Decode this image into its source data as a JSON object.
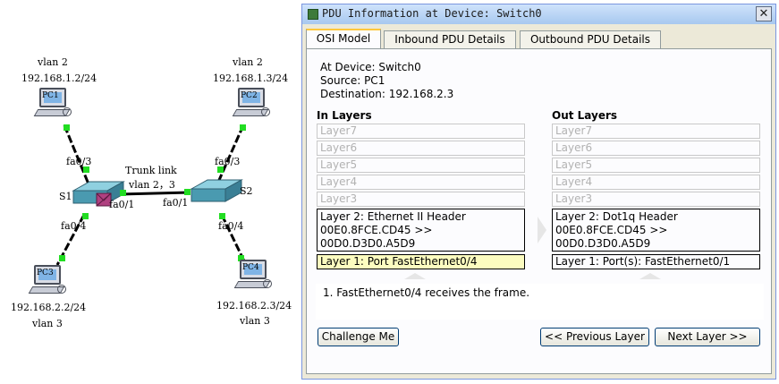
{
  "topology": {
    "pc1": {
      "label": "PC1",
      "vlan": "vlan 2",
      "ip": "192.168.1.2/24",
      "port": "fa0/3"
    },
    "pc2": {
      "label": "PC2",
      "vlan": "vlan 2",
      "ip": "192.168.1.3/24",
      "port": "fa0/3"
    },
    "pc3": {
      "label": "PC3",
      "vlan": "vlan 3",
      "ip": "192.168.2.2/24",
      "port": "fa0/4"
    },
    "pc4": {
      "label": "PC4",
      "vlan": "vlan 3",
      "ip": "192.168.2.3/24",
      "port": "fa0/4"
    },
    "s1": {
      "label": "S1",
      "trunk_port": "fa0/1"
    },
    "s2": {
      "label": "S2",
      "trunk_port": "fa0/1"
    },
    "trunk": {
      "label": "Trunk link",
      "vlans": "vlan 2，3"
    },
    "colors": {
      "link": "#000000",
      "port_led": "#22dd22",
      "switch": "#4a9ab0",
      "pdu": "#b04080"
    }
  },
  "dialog": {
    "title": "PDU Information at Device: Switch0",
    "close_glyph": "✕",
    "tabs": [
      "OSI Model",
      "Inbound PDU Details",
      "Outbound PDU Details"
    ],
    "active_tab": "OSI Model",
    "at_device": "At Device: Switch0",
    "source": "Source: PC1",
    "destination": "Destination: 192.168.2.3",
    "in_layers": {
      "header": "In Layers",
      "inactive": [
        "Layer7",
        "Layer6",
        "Layer5",
        "Layer4",
        "Layer3"
      ],
      "layer2": [
        "Layer 2: Ethernet II Header",
        "00E0.8FCE.CD45 >>",
        "00D0.D3D0.A5D9"
      ],
      "layer1": "Layer 1: Port FastEthernet0/4"
    },
    "out_layers": {
      "header": "Out Layers",
      "inactive": [
        "Layer7",
        "Layer6",
        "Layer5",
        "Layer4",
        "Layer3"
      ],
      "layer2": [
        "Layer 2: Dot1q Header",
        "00E0.8FCE.CD45 >>",
        "00D0.D3D0.A5D9"
      ],
      "layer1": "Layer 1: Port(s): FastEthernet0/1"
    },
    "description": "1. FastEthernet0/4 receives the frame.",
    "buttons": {
      "challenge": "Challenge Me",
      "previous": "<< Previous Layer",
      "next": "Next Layer >>"
    }
  }
}
